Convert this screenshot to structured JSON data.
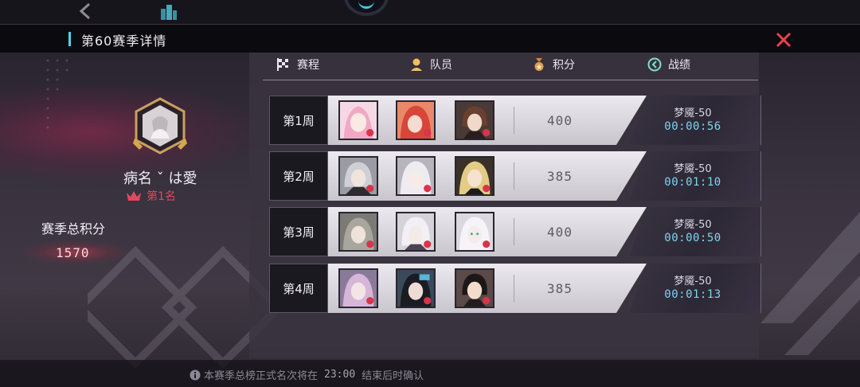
{
  "window": {
    "title": "第60赛季详情"
  },
  "tabs": [
    {
      "label": "赛程",
      "icon": "checkered-flag-icon"
    },
    {
      "label": "队员",
      "icon": "member-icon"
    },
    {
      "label": "积分",
      "icon": "medal-icon"
    },
    {
      "label": "战绩",
      "icon": "record-icon"
    }
  ],
  "player": {
    "name": "病名 ˇ は愛",
    "rank": "第1名",
    "total_label": "赛季总积分",
    "total_value": "1570"
  },
  "weeks": [
    {
      "label": "第1周",
      "score": "400",
      "difficulty": "梦魇-50",
      "time": "00:00:56",
      "members": [
        "pink-hair-character",
        "red-hair-character",
        "brown-hair-character"
      ]
    },
    {
      "label": "第2周",
      "score": "385",
      "difficulty": "梦魇-50",
      "time": "00:01:10",
      "members": [
        "grey-hair-character",
        "white-hair-character",
        "blonde-hair-character"
      ]
    },
    {
      "label": "第3周",
      "score": "400",
      "difficulty": "梦魇-50",
      "time": "00:00:50",
      "members": [
        "ash-hair-character",
        "silver-hair-character",
        "pale-hair-character"
      ]
    },
    {
      "label": "第4周",
      "score": "385",
      "difficulty": "梦魇-50",
      "time": "00:01:13",
      "members": [
        "lilac-hair-character",
        "dark-hair-character",
        "black-hair-character"
      ]
    }
  ],
  "notice": {
    "prefix": "本赛季总榜正式名次将在",
    "time": "23:00",
    "suffix": "结束后时确认"
  },
  "colors": {
    "accent": "#4fd3f0",
    "rank": "#e04a5c",
    "time": "#79d7ee",
    "close": "#e8434f"
  }
}
